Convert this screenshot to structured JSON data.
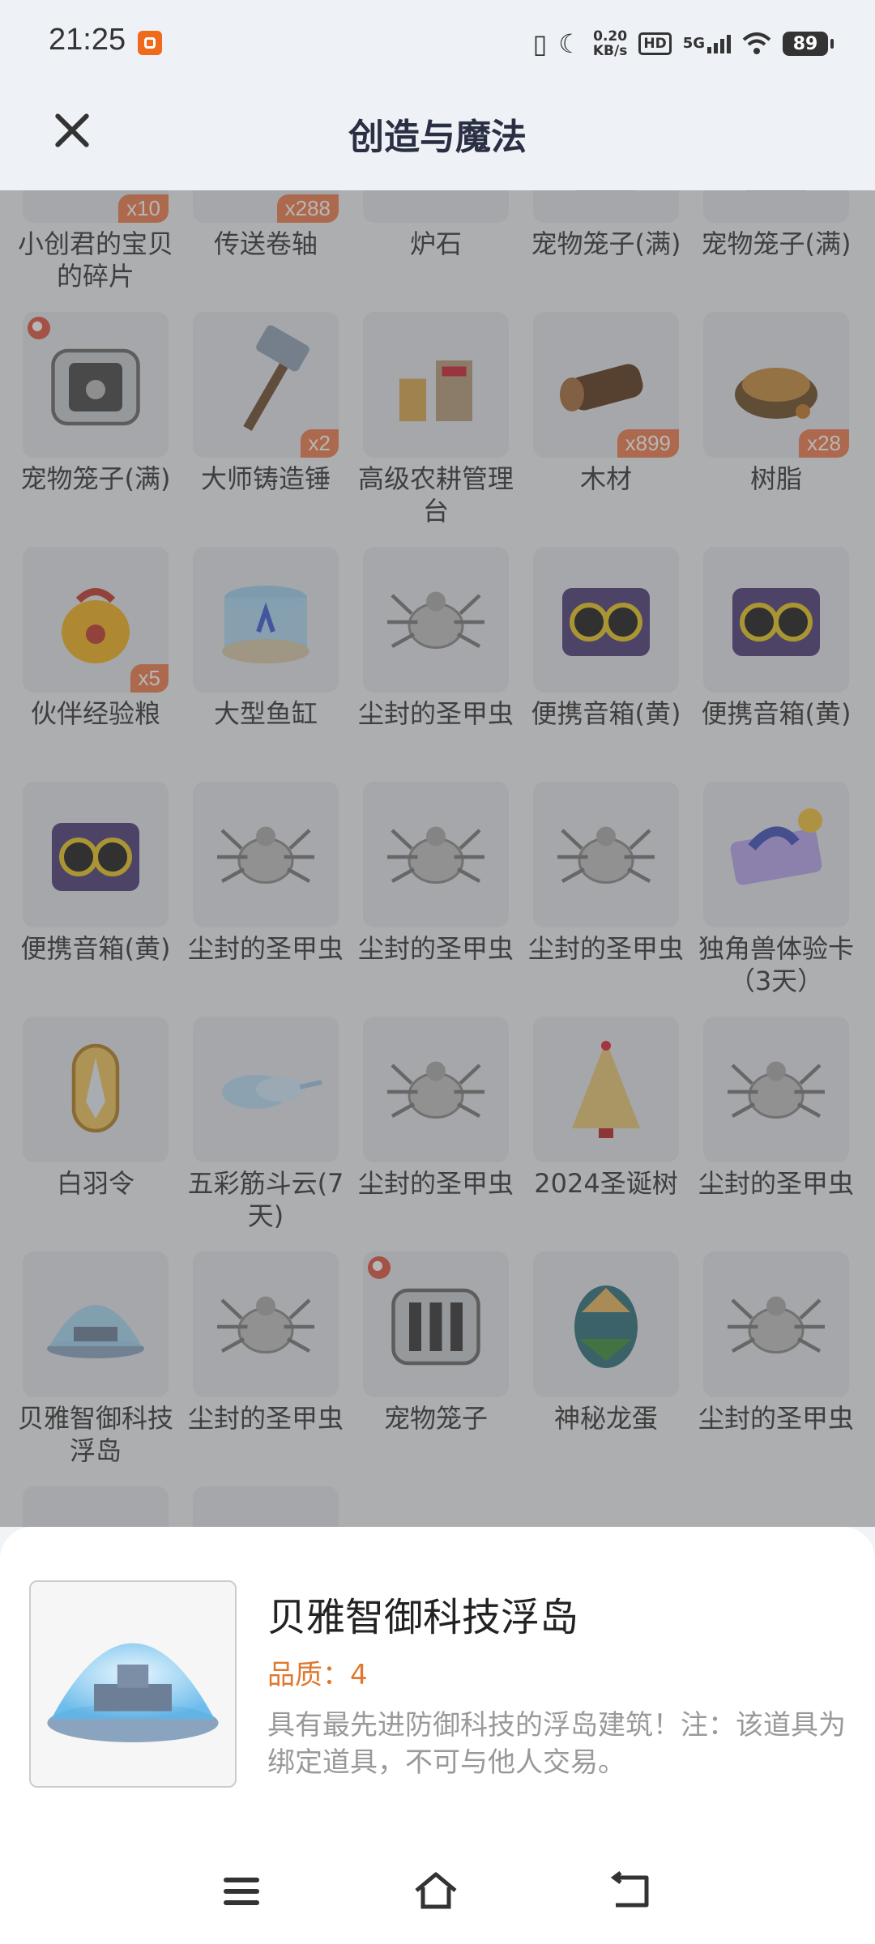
{
  "status_bar": {
    "time": "21:25",
    "speed_value": "0.20",
    "speed_unit": "KB/s",
    "hd": "HD",
    "network": "5G",
    "battery": "89"
  },
  "header": {
    "title": "创造与魔法"
  },
  "items": [
    {
      "name": "小创君的宝贝的碎片",
      "count": "x10",
      "icon": "fragment"
    },
    {
      "name": "传送卷轴",
      "count": "x288",
      "icon": "scroll"
    },
    {
      "name": "炉石",
      "count": "",
      "icon": "hearthstone"
    },
    {
      "name": "宠物笼子(满)",
      "count": "",
      "icon": "cage"
    },
    {
      "name": "宠物笼子(满)",
      "count": "",
      "icon": "cage"
    },
    {
      "name": "宠物笼子(满)",
      "count": "",
      "icon": "cage",
      "paw": true
    },
    {
      "name": "大师铸造锤",
      "count": "x2",
      "icon": "hammer"
    },
    {
      "name": "高级农耕管理台",
      "count": "",
      "icon": "farm-station"
    },
    {
      "name": "木材",
      "count": "x899",
      "icon": "wood"
    },
    {
      "name": "树脂",
      "count": "x28",
      "icon": "resin"
    },
    {
      "name": "伙伴经验粮",
      "count": "x5",
      "icon": "food-bag"
    },
    {
      "name": "大型鱼缸",
      "count": "",
      "icon": "fish-tank"
    },
    {
      "name": "尘封的圣甲虫",
      "count": "",
      "icon": "beetle"
    },
    {
      "name": "便携音箱(黄)",
      "count": "",
      "icon": "speaker"
    },
    {
      "name": "便携音箱(黄)",
      "count": "",
      "icon": "speaker"
    },
    {
      "name": "便携音箱(黄)",
      "count": "",
      "icon": "speaker"
    },
    {
      "name": "尘封的圣甲虫",
      "count": "",
      "icon": "beetle"
    },
    {
      "name": "尘封的圣甲虫",
      "count": "",
      "icon": "beetle"
    },
    {
      "name": "尘封的圣甲虫",
      "count": "",
      "icon": "beetle"
    },
    {
      "name": "独角兽体验卡（3天）",
      "count": "",
      "icon": "unicorn-card"
    },
    {
      "name": "白羽令",
      "count": "",
      "icon": "feather-token"
    },
    {
      "name": "五彩筋斗云(7天)",
      "count": "",
      "icon": "cloud"
    },
    {
      "name": "尘封的圣甲虫",
      "count": "",
      "icon": "beetle"
    },
    {
      "name": "2024圣诞树",
      "count": "",
      "icon": "xmas-tree"
    },
    {
      "name": "尘封的圣甲虫",
      "count": "",
      "icon": "beetle"
    },
    {
      "name": "贝雅智御科技浮岛",
      "count": "",
      "icon": "dome-island"
    },
    {
      "name": "尘封的圣甲虫",
      "count": "",
      "icon": "beetle"
    },
    {
      "name": "宠物笼子",
      "count": "",
      "icon": "cage-empty",
      "paw": true
    },
    {
      "name": "神秘龙蛋",
      "count": "",
      "icon": "dragon-egg"
    },
    {
      "name": "尘封的圣甲虫",
      "count": "",
      "icon": "beetle"
    },
    {
      "name": "",
      "count": "",
      "icon": "beetle"
    },
    {
      "name": "",
      "count": "",
      "icon": "beetle"
    }
  ],
  "detail": {
    "name": "贝雅智御科技浮岛",
    "quality": "品质：4",
    "description": "具有最先进防御科技的浮岛建筑！注：该道具为绑定道具，不可与他人交易。",
    "icon": "dome-island"
  },
  "system_nav": {
    "menu": "menu-icon",
    "home": "home-icon",
    "back": "back-icon"
  }
}
